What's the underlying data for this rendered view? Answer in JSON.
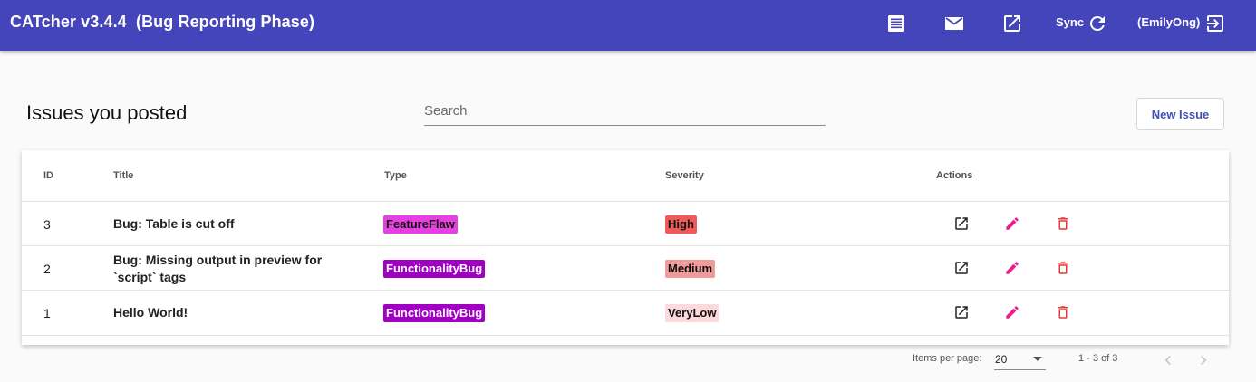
{
  "header": {
    "app_title": "CATcher v3.4.4  (Bug Reporting Phase)",
    "sync_label": "Sync",
    "user_label": "(EmilyOng)",
    "icons": [
      "list-icon",
      "mail-icon",
      "open-in-new-icon",
      "refresh-icon",
      "logout-icon"
    ],
    "color": "#4444bb"
  },
  "page": {
    "title": "Issues you posted",
    "search_placeholder": "Search",
    "new_issue_label": "New Issue"
  },
  "table": {
    "columns": {
      "id": "ID",
      "title": "Title",
      "type": "Type",
      "severity": "Severity",
      "actions": "Actions"
    },
    "rows": [
      {
        "id": "3",
        "title": "Bug: Table is cut off",
        "type": "FeatureFlaw",
        "severity": "High"
      },
      {
        "id": "2",
        "title": "Bug: Missing output in preview for `script` tags",
        "type": "FunctionalityBug",
        "severity": "Medium"
      },
      {
        "id": "1",
        "title": "Hello World!",
        "type": "FunctionalityBug",
        "severity": "VeryLow"
      }
    ],
    "tag_colors": {
      "FeatureFlaw": "#e83fe0",
      "FunctionalityBug": "#a100c4",
      "High": "#ee5a5a",
      "Medium": "#f09a9a",
      "VeryLow": "#fcd9db"
    },
    "action_icons": [
      "open-in-new-icon",
      "edit-icon",
      "delete-icon"
    ]
  },
  "paginator": {
    "items_per_page_label": "Items per page:",
    "page_size": "20",
    "range_label": "1 - 3 of 3"
  }
}
